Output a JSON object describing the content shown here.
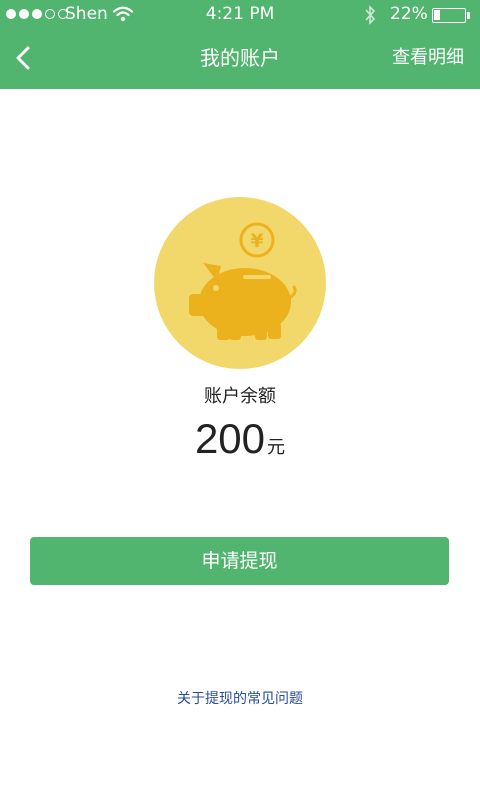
{
  "status_bar": {
    "carrier": "Shen",
    "time": "4:21 PM",
    "battery_pct": "22%",
    "battery_level": 0.22,
    "signal_filled": 3,
    "signal_total": 5
  },
  "header": {
    "title": "我的账户",
    "details_label": "查看明细"
  },
  "account": {
    "balance_label": "账户余额",
    "balance_value": "200",
    "balance_unit": "元"
  },
  "actions": {
    "withdraw_label": "申请提现",
    "faq_label": "关于提现的常见问题"
  },
  "colors": {
    "brand_green": "#51b56f",
    "piggy_bg": "#f2d86a",
    "piggy_body": "#ebb21e",
    "link_blue": "#2a4a9c"
  },
  "icons": {
    "back": "chevron-left-icon",
    "piggy": "piggy-bank-icon",
    "coin": "yuan-coin-icon"
  }
}
